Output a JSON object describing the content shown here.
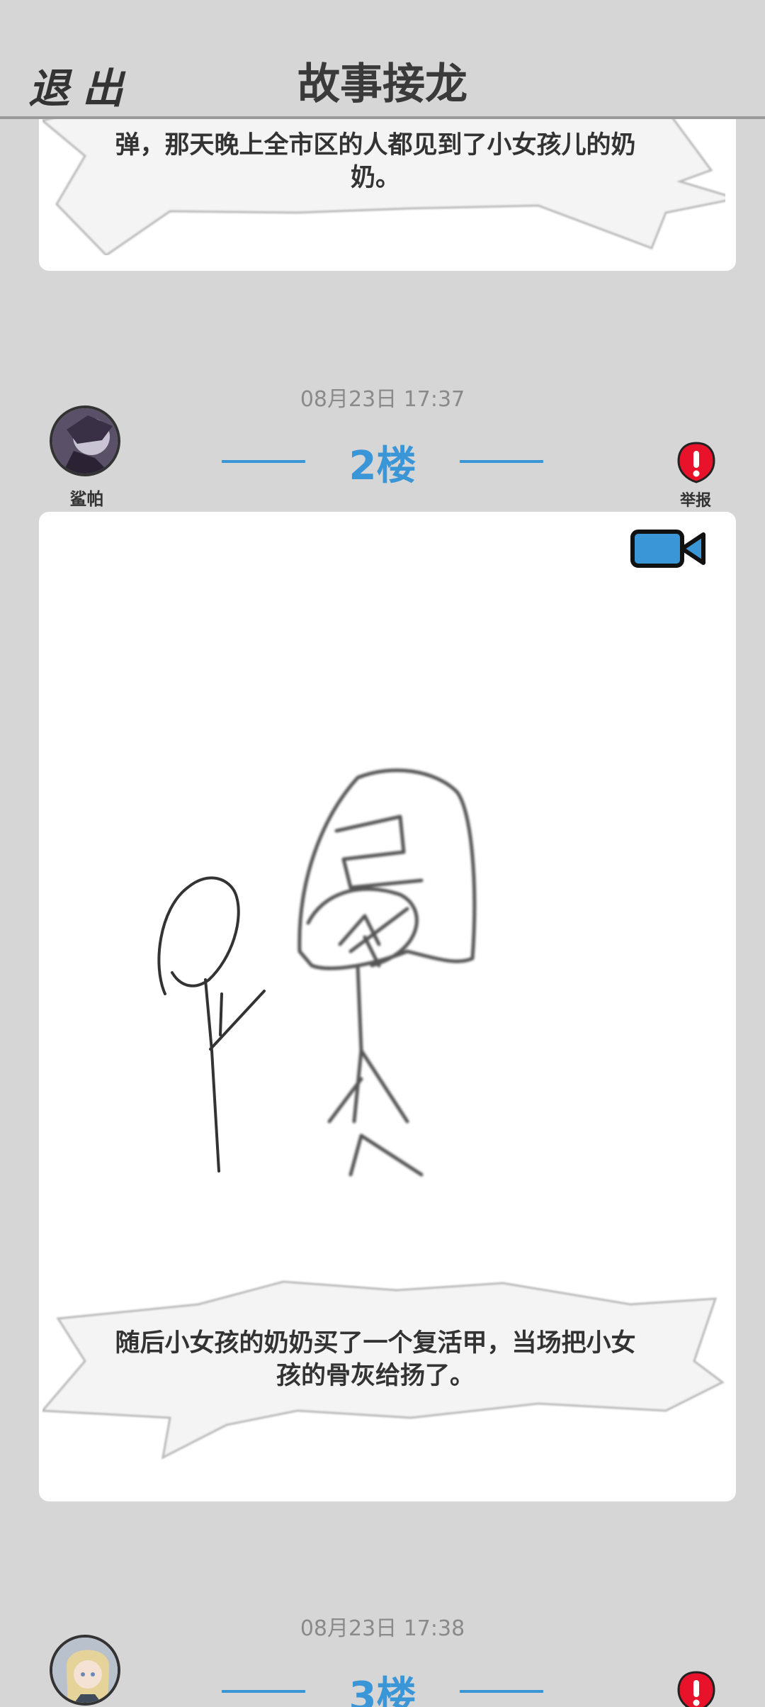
{
  "header": {
    "exit_label": "退出",
    "title": "故事接龙"
  },
  "posts": [
    {
      "text": "弹，那天晚上全市区的人都见到了小女孩儿的奶奶。"
    },
    {
      "time": "08月23日  17:37",
      "floor": "2楼",
      "user": "鲨帕",
      "report_label": "举报",
      "text": "随后小女孩的奶奶买了一个复活甲，当场把小女孩的骨灰给扬了。",
      "video_icon": "video-camera-icon"
    },
    {
      "time": "08月23日  17:38",
      "floor": "3楼"
    }
  ],
  "colors": {
    "accent": "#3a96d6",
    "report": "#e8132b",
    "background": "#d6d6d6"
  }
}
